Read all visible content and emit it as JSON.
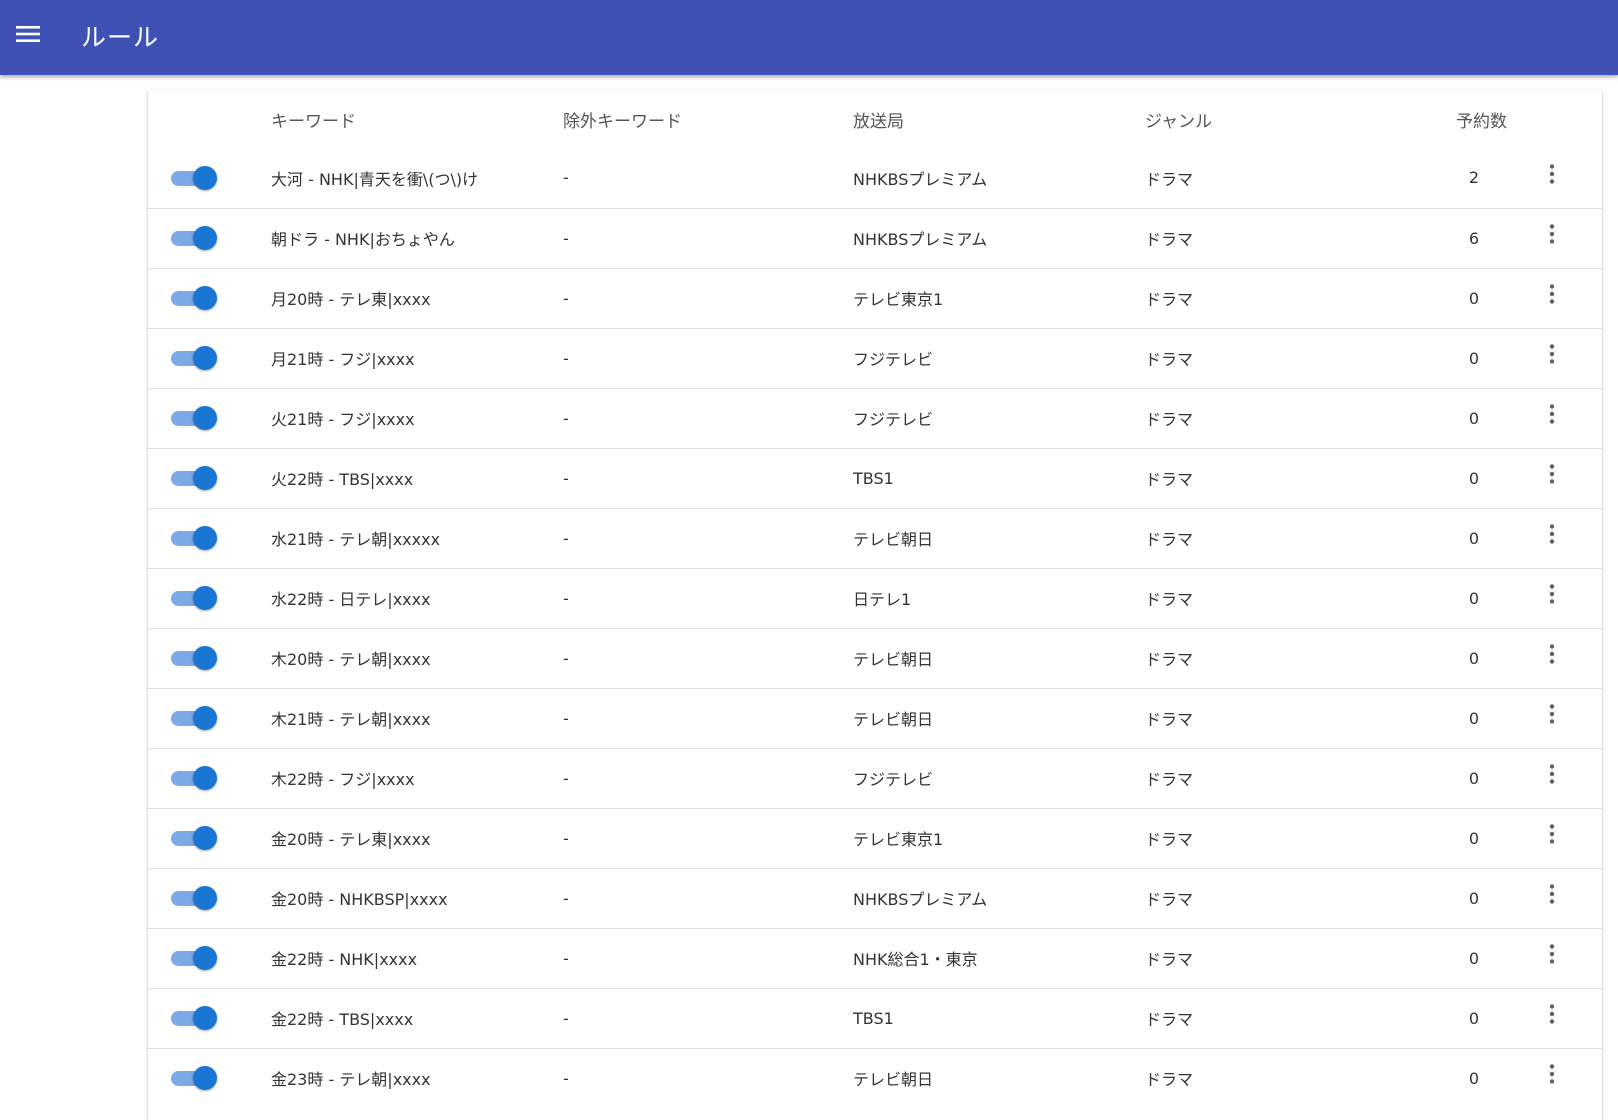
{
  "appbar": {
    "title": "ルール",
    "menu_icon": "menu-icon"
  },
  "colors": {
    "appbar": "#3f51b5",
    "toggle_thumb": "#1976d2",
    "toggle_track": "#7ba9e6"
  },
  "table": {
    "headers": {
      "keyword": "キーワード",
      "exclude": "除外キーワード",
      "station": "放送局",
      "genre": "ジャンル",
      "count": "予約数"
    },
    "rows": [
      {
        "enabled": true,
        "keyword": "大河 - NHK|青天を衝\\(つ\\)け",
        "exclude": "-",
        "station": "NHKBSプレミアム",
        "genre": "ドラマ",
        "count": "2"
      },
      {
        "enabled": true,
        "keyword": "朝ドラ - NHK|おちょやん",
        "exclude": "-",
        "station": "NHKBSプレミアム",
        "genre": "ドラマ",
        "count": "6"
      },
      {
        "enabled": true,
        "keyword": "月20時 - テレ東|xxxx",
        "exclude": "-",
        "station": "テレビ東京1",
        "genre": "ドラマ",
        "count": "0"
      },
      {
        "enabled": true,
        "keyword": "月21時 - フジ|xxxx",
        "exclude": "-",
        "station": "フジテレビ",
        "genre": "ドラマ",
        "count": "0"
      },
      {
        "enabled": true,
        "keyword": "火21時 - フジ|xxxx",
        "exclude": "-",
        "station": "フジテレビ",
        "genre": "ドラマ",
        "count": "0"
      },
      {
        "enabled": true,
        "keyword": "火22時 - TBS|xxxx",
        "exclude": "-",
        "station": "TBS1",
        "genre": "ドラマ",
        "count": "0"
      },
      {
        "enabled": true,
        "keyword": "水21時 - テレ朝|xxxxx",
        "exclude": "-",
        "station": "テレビ朝日",
        "genre": "ドラマ",
        "count": "0"
      },
      {
        "enabled": true,
        "keyword": "水22時 - 日テレ|xxxx",
        "exclude": "-",
        "station": "日テレ1",
        "genre": "ドラマ",
        "count": "0"
      },
      {
        "enabled": true,
        "keyword": "木20時 - テレ朝|xxxx",
        "exclude": "-",
        "station": "テレビ朝日",
        "genre": "ドラマ",
        "count": "0"
      },
      {
        "enabled": true,
        "keyword": "木21時 - テレ朝|xxxx",
        "exclude": "-",
        "station": "テレビ朝日",
        "genre": "ドラマ",
        "count": "0"
      },
      {
        "enabled": true,
        "keyword": "木22時 - フジ|xxxx",
        "exclude": "-",
        "station": "フジテレビ",
        "genre": "ドラマ",
        "count": "0"
      },
      {
        "enabled": true,
        "keyword": "金20時 - テレ東|xxxx",
        "exclude": "-",
        "station": "テレビ東京1",
        "genre": "ドラマ",
        "count": "0"
      },
      {
        "enabled": true,
        "keyword": "金20時 - NHKBSP|xxxx",
        "exclude": "-",
        "station": "NHKBSプレミアム",
        "genre": "ドラマ",
        "count": "0"
      },
      {
        "enabled": true,
        "keyword": "金22時 - NHK|xxxx",
        "exclude": "-",
        "station": "NHK総合1・東京",
        "genre": "ドラマ",
        "count": "0"
      },
      {
        "enabled": true,
        "keyword": "金22時 - TBS|xxxx",
        "exclude": "-",
        "station": "TBS1",
        "genre": "ドラマ",
        "count": "0"
      },
      {
        "enabled": true,
        "keyword": "金23時 - テレ朝|xxxx",
        "exclude": "-",
        "station": "テレビ朝日",
        "genre": "ドラマ",
        "count": "0"
      }
    ]
  }
}
